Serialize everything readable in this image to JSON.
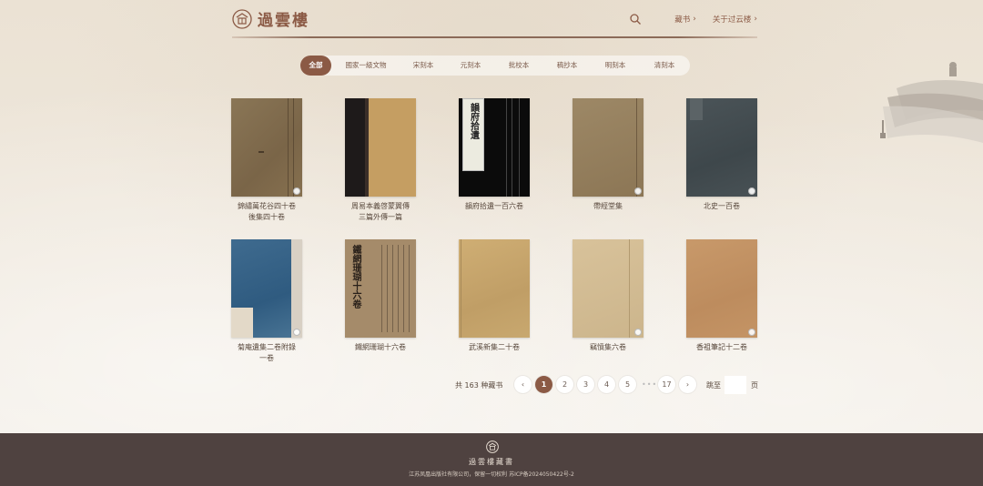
{
  "header": {
    "logo_text": "過雲樓",
    "nav": [
      {
        "label": "藏书"
      },
      {
        "label": "关于过云楼"
      }
    ]
  },
  "tabs": [
    {
      "label": "全部",
      "active": true
    },
    {
      "label": "國家一級文物"
    },
    {
      "label": "宋刻本"
    },
    {
      "label": "元刻本"
    },
    {
      "label": "批校本"
    },
    {
      "label": "稿抄本"
    },
    {
      "label": "明刻本"
    },
    {
      "label": "清刻本"
    }
  ],
  "books": [
    {
      "line1": "錦繡萬花谷四十卷",
      "line2": "後集四十卷"
    },
    {
      "line1": "周易本義啓蒙翼傳",
      "line2": "三篇外傳一篇"
    },
    {
      "line1": "韻府拾遺一百六卷",
      "line2": ""
    },
    {
      "line1": "帶經堂集",
      "line2": ""
    },
    {
      "line1": "北史一百卷",
      "line2": ""
    },
    {
      "line1": "菊庵遺集二卷附錄",
      "line2": "一卷"
    },
    {
      "line1": "鐵網珊瑚十六卷",
      "line2": ""
    },
    {
      "line1": "武溪新集二十卷",
      "line2": ""
    },
    {
      "line1": "竊憤集六卷",
      "line2": ""
    },
    {
      "line1": "香祖筆記十二卷",
      "line2": ""
    }
  ],
  "cover_text": {
    "book3": "韻府拾遺",
    "book7": "鐵網珊瑚十六卷"
  },
  "pagination": {
    "total": "共 163 种藏书",
    "pages": [
      "1",
      "2",
      "3",
      "4",
      "5"
    ],
    "dots": "•••",
    "last": "17",
    "prev": "‹",
    "next": "›",
    "jump_label": "跳至",
    "page_unit": "页"
  },
  "footer": {
    "name": "過雲樓藏書",
    "copyright": "江苏凤凰出版社有限公司，保留一切权利 苏ICP备2024050422号-2"
  },
  "colors": {
    "accent": "#8b5a45",
    "footer_bg": "#4f4240",
    "page_bg": "#efe7db"
  }
}
